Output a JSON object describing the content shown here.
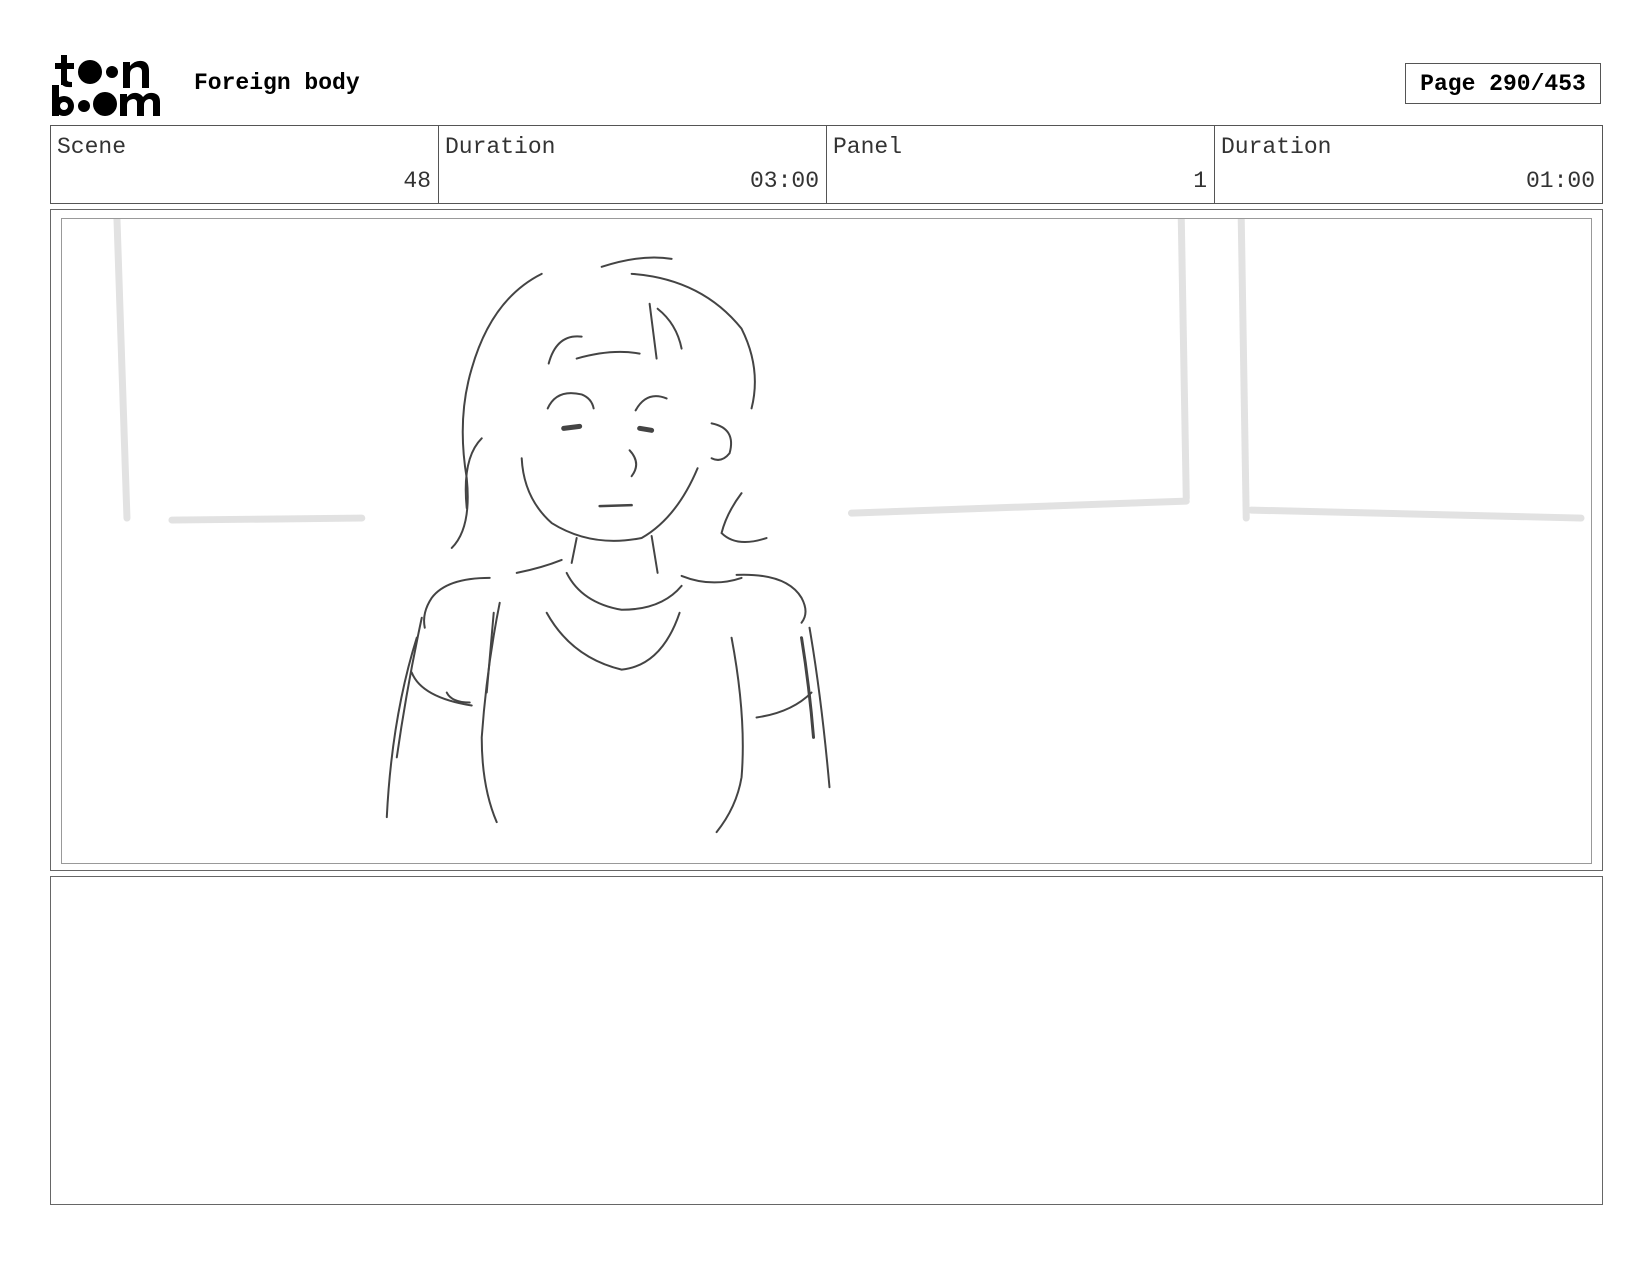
{
  "header": {
    "logo_text": "toon boom",
    "title": "Foreign body",
    "page": "Page 290/453"
  },
  "info": {
    "scene_label": "Scene",
    "scene_value": "48",
    "scene_duration_label": "Duration",
    "scene_duration_value": "03:00",
    "panel_label": "Panel",
    "panel_value": "1",
    "panel_duration_label": "Duration",
    "panel_duration_value": "01:00"
  },
  "panel": {
    "image": "sketch-woman-portrait"
  },
  "notes": {
    "text": ""
  }
}
